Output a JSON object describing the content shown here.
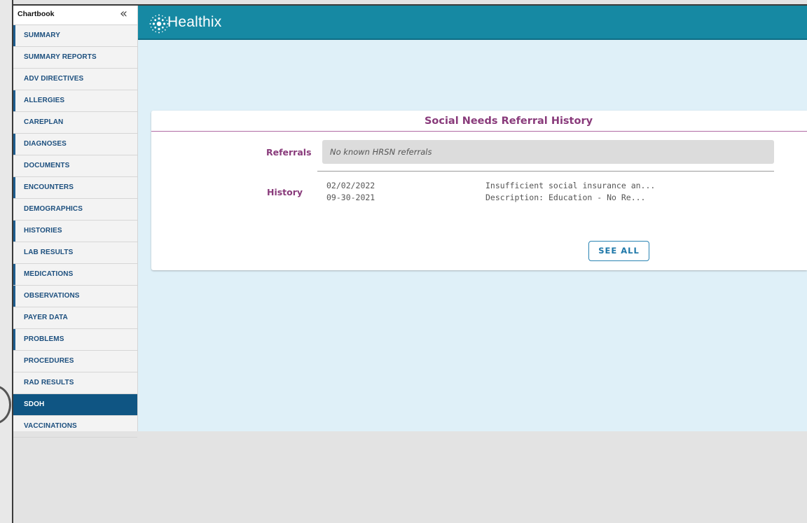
{
  "sidebar": {
    "title": "Chartbook",
    "collapse_icon": "«",
    "items": [
      {
        "label": "SUMMARY"
      },
      {
        "label": "SUMMARY REPORTS"
      },
      {
        "label": "ADV DIRECTIVES"
      },
      {
        "label": "ALLERGIES"
      },
      {
        "label": "CAREPLAN"
      },
      {
        "label": "DIAGNOSES"
      },
      {
        "label": "DOCUMENTS"
      },
      {
        "label": "ENCOUNTERS"
      },
      {
        "label": "DEMOGRAPHICS"
      },
      {
        "label": "HISTORIES"
      },
      {
        "label": "LAB RESULTS"
      },
      {
        "label": "MEDICATIONS"
      },
      {
        "label": "OBSERVATIONS"
      },
      {
        "label": "PAYER DATA"
      },
      {
        "label": "PROBLEMS"
      },
      {
        "label": "PROCEDURES"
      },
      {
        "label": "RAD RESULTS"
      },
      {
        "label": "SDOH"
      },
      {
        "label": "VACCINATIONS"
      }
    ],
    "active": "SDOH"
  },
  "header": {
    "brand": "Healthix",
    "logo_icon": "healthix-logo-icon"
  },
  "card": {
    "title": "Social Needs Referral History",
    "referrals_label": "Referrals",
    "referrals_value": "No known HRSN referrals",
    "history_label": "History",
    "history": [
      {
        "date": "02/02/2022",
        "description": "Insufficient social insurance an..."
      },
      {
        "date": "09-30-2021",
        "description": "Description: Education - No Re..."
      }
    ],
    "see_all_label": "SEE ALL"
  },
  "colors": {
    "header_bg": "#1689a3",
    "main_bg": "#dff0f8",
    "accent_purple": "#893b7b",
    "active_nav": "#0f5583",
    "nav_text": "#1c4f7e"
  }
}
